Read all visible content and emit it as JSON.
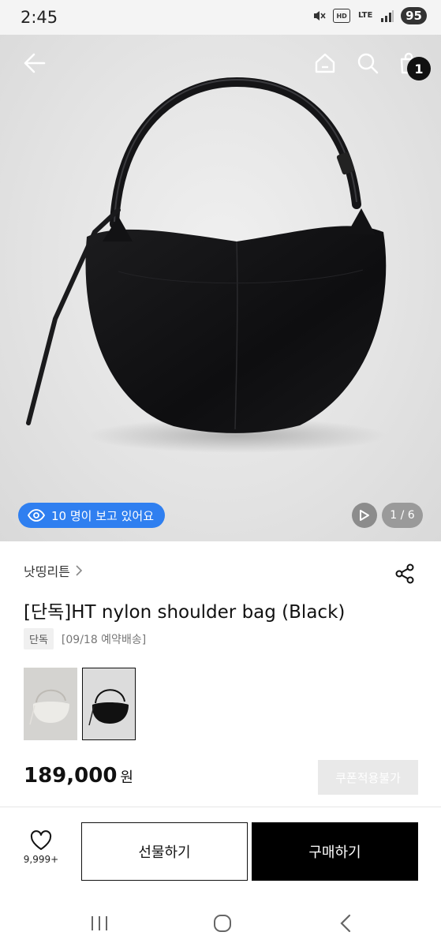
{
  "status_bar": {
    "time": "2:45",
    "hd_label": "HD",
    "lte_label": "LTE",
    "battery": "95",
    "icons": [
      "mute-icon",
      "hd-voice-icon",
      "lte-icon",
      "signal-icon",
      "battery-icon"
    ]
  },
  "header": {
    "cart_count": "1",
    "icons": [
      "back-arrow-icon",
      "home-icon",
      "search-icon",
      "shopping-bag-icon"
    ]
  },
  "hero": {
    "viewer_text": "10 명이 보고 있어요",
    "page_counter": "1 / 6",
    "icons": [
      "eye-icon",
      "play-icon"
    ]
  },
  "product": {
    "brand": "낫띵리튼",
    "title": "[단독]HT nylon shoulder bag (Black)",
    "tag": "단독",
    "shipping_note": "[09/18 예약배송]",
    "price": "189,000",
    "currency": "원",
    "coupon_label": "쿠폰적용불가"
  },
  "actions": {
    "like_count": "9,999+",
    "gift_label": "선물하기",
    "buy_label": "구매하기"
  },
  "colors": {
    "accent_blue": "#2f7ff0",
    "buy_button": "#000000"
  }
}
